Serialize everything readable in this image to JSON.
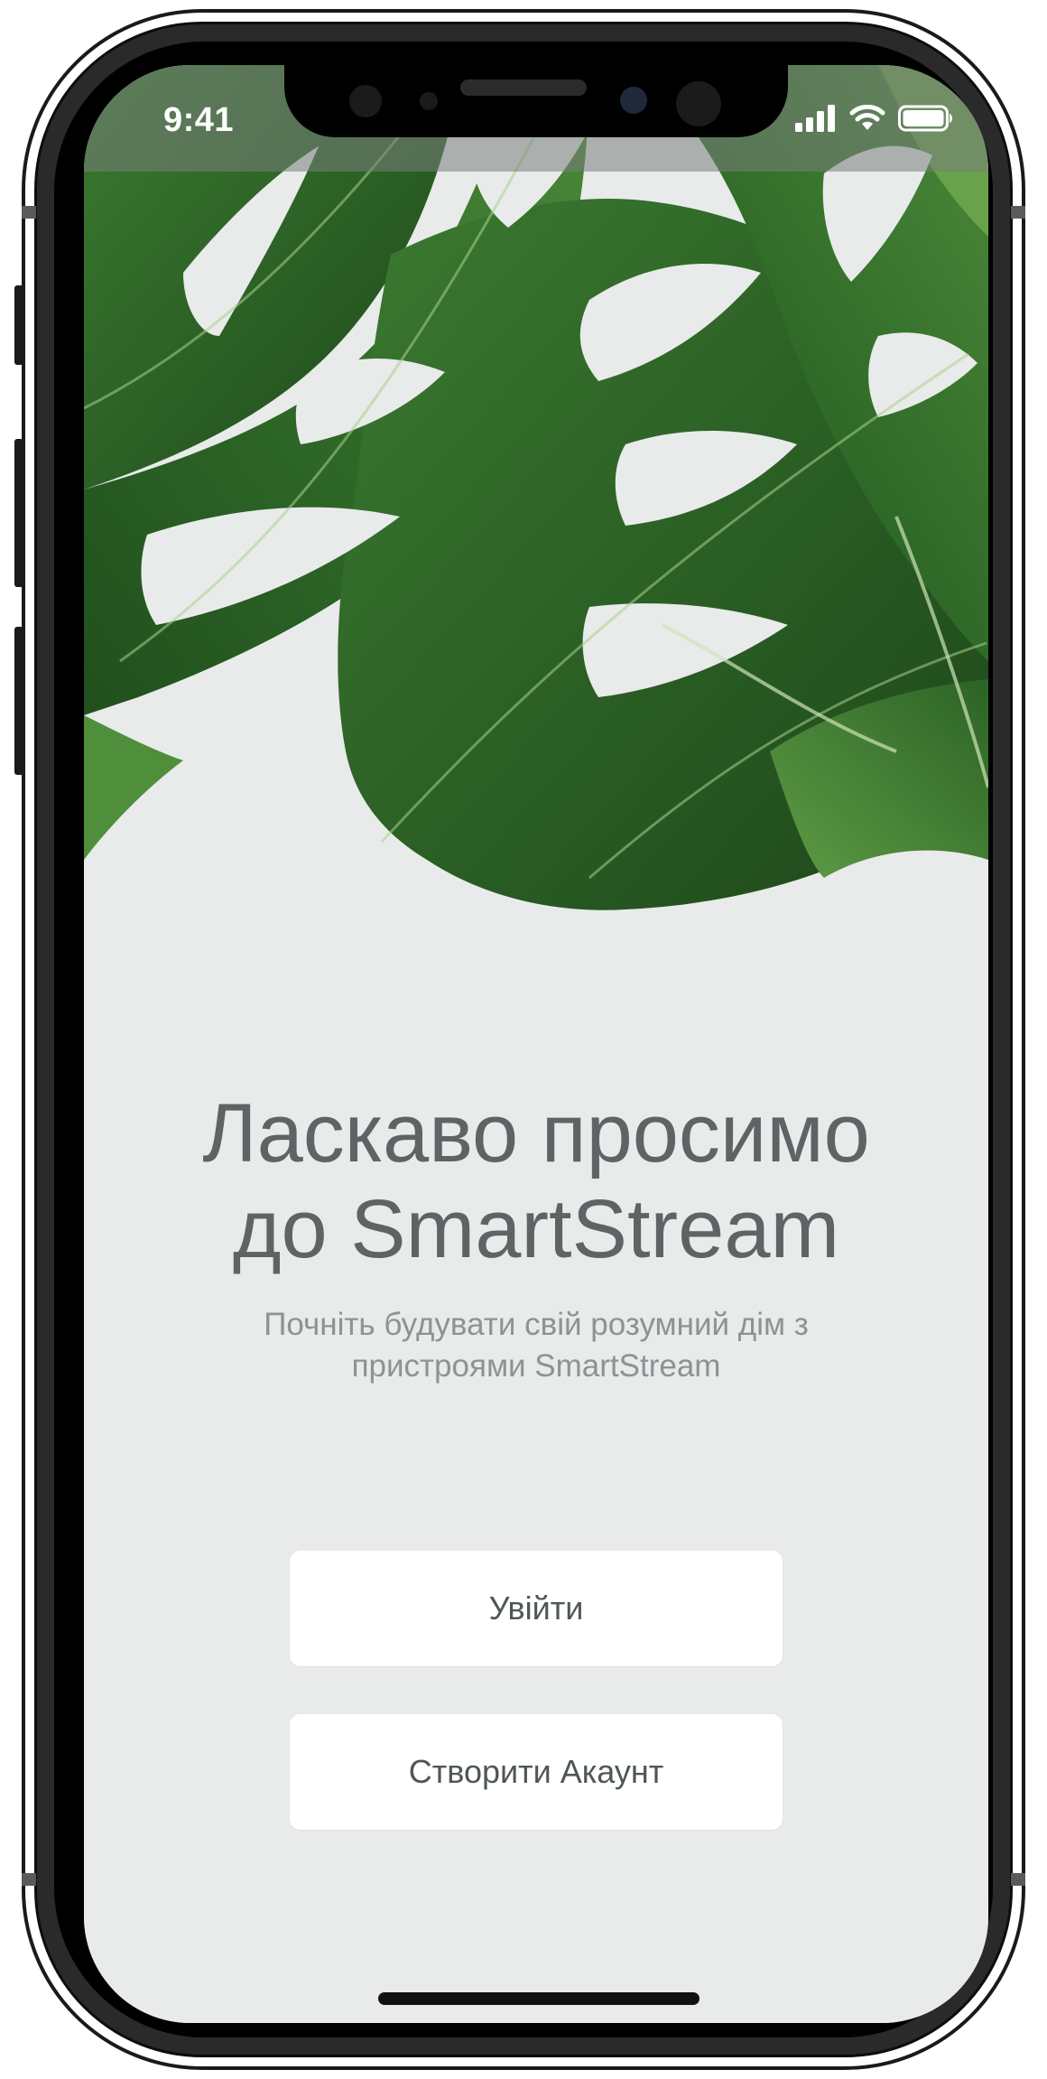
{
  "status_bar": {
    "time": "9:41",
    "icons": [
      "cellular-signal-icon",
      "wifi-icon",
      "battery-icon"
    ]
  },
  "hero": {
    "image": "monstera-leaf-illustration"
  },
  "welcome": {
    "title_line1": "Ласкаво просимо",
    "title_line2": "до SmartStream",
    "subtitle_line1": "Почніть будувати свій розумний дім з",
    "subtitle_line2": "пристроями SmartStream"
  },
  "actions": {
    "login_label": "Увійти",
    "create_account_label": "Створити Акаунт"
  },
  "colors": {
    "screen_background": "#e8ebea",
    "title_text": "#5e6466",
    "subtitle_text": "#8d9294",
    "button_background": "#ffffff",
    "button_text": "#4f5658",
    "leaf_dark": "#1f4d1c",
    "leaf_light": "#7fae5c"
  }
}
